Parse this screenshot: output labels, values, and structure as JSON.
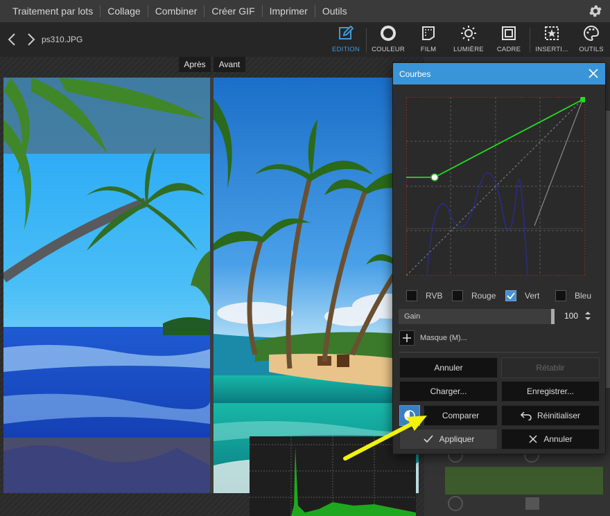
{
  "menu": {
    "items": [
      "Traitement par lots",
      "Collage",
      "Combiner",
      "Créer GIF",
      "Imprimer",
      "Outils"
    ],
    "settings_icon": "gear-icon"
  },
  "toolbar": {
    "filename": "ps310.JPG",
    "tools": [
      {
        "label": "EDITION",
        "icon": "edit-icon",
        "active": true
      },
      {
        "label": "COULEUR",
        "icon": "color-circle-icon",
        "active": false
      },
      {
        "label": "FILM",
        "icon": "film-icon",
        "active": false
      },
      {
        "label": "LUMIÈRE",
        "icon": "sun-icon",
        "active": false
      },
      {
        "label": "CADRE",
        "icon": "frame-icon",
        "active": false
      },
      {
        "label": "INSERTI...",
        "icon": "insert-icon",
        "active": false
      },
      {
        "label": "OUTILS",
        "icon": "palette-icon",
        "active": false
      }
    ]
  },
  "view": {
    "after_label": "Après",
    "before_label": "Avant"
  },
  "dialog": {
    "title": "Courbes",
    "channels": [
      {
        "label": "RVB",
        "checked": false
      },
      {
        "label": "Rouge",
        "checked": false
      },
      {
        "label": "Vert",
        "checked": true
      },
      {
        "label": "Bleu",
        "checked": false
      }
    ],
    "gain_label": "Gain",
    "gain_value": "100",
    "mask_label": "Masque (M)...",
    "buttons": {
      "cancel_top": "Annuler",
      "redo": "Rétablir",
      "load": "Charger...",
      "save": "Enregistrer...",
      "compare": "Comparer",
      "reset": "Réinitialiser",
      "apply": "Appliquer",
      "cancel": "Annuler"
    }
  },
  "colors": {
    "accent": "#3a95d8",
    "curve": "#22dd22",
    "arrow": "#f2f20a"
  }
}
